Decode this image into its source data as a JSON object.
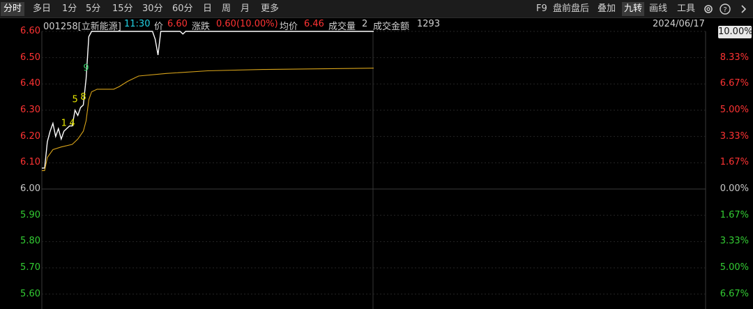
{
  "toolbar": {
    "tabs": [
      "分时",
      "多日",
      "1分",
      "5分",
      "15分",
      "30分",
      "60分",
      "日",
      "周",
      "月",
      "更多"
    ],
    "right_items": [
      "F9",
      "盘前盘后",
      "叠加",
      "九转",
      "画线",
      "工具"
    ],
    "icons": [
      "gear-icon",
      "help-icon",
      "close-icon",
      "chevron-right-icon"
    ]
  },
  "info_bar": {
    "code_name": "001258[立新能源]",
    "time": "11:30",
    "price_label": "价",
    "price": "6.60",
    "change_label": "涨跌",
    "change": "0.60(10.00%)",
    "avg_label": "均价",
    "avg": "6.46",
    "volume_label": "成交量",
    "volume": "2",
    "amount_label": "成交金额",
    "amount": "1293",
    "date": "2024/06/17"
  },
  "colors": {
    "up": "#ff3333",
    "down": "#33cc33",
    "price_line": "#ffffff",
    "avg_line": "#d9a41a",
    "grid": "#333333",
    "nine_turn": "#e6e600",
    "nine_final": "#33cc66"
  },
  "chart_data": {
    "type": "line",
    "prev_close": 6.0,
    "y_ticks": [
      "6.60",
      "6.50",
      "6.40",
      "6.30",
      "6.20",
      "6.10",
      "6.00",
      "5.90",
      "5.80",
      "5.70",
      "5.60"
    ],
    "pct_ticks": [
      "10.00%",
      "8.33%",
      "6.67%",
      "5.00%",
      "3.33%",
      "1.67%",
      "0.00%",
      "1.67%",
      "3.33%",
      "5.00%",
      "6.67%"
    ],
    "ylim": [
      5.58,
      6.62
    ],
    "session_minutes": 240,
    "series": [
      {
        "type": "price",
        "points": [
          [
            0,
            6.08
          ],
          [
            1,
            6.08
          ],
          [
            2,
            6.18
          ],
          [
            3,
            6.22
          ],
          [
            4,
            6.25
          ],
          [
            5,
            6.2
          ],
          [
            6,
            6.23
          ],
          [
            7,
            6.19
          ],
          [
            8,
            6.22
          ],
          [
            9,
            6.23
          ],
          [
            10,
            6.24
          ],
          [
            11,
            6.24
          ],
          [
            12,
            6.3
          ],
          [
            13,
            6.28
          ],
          [
            14,
            6.31
          ],
          [
            15,
            6.32
          ],
          [
            16,
            6.42
          ],
          [
            17,
            6.58
          ],
          [
            18,
            6.6
          ],
          [
            19,
            6.6
          ],
          [
            40,
            6.6
          ],
          [
            41,
            6.57
          ],
          [
            42,
            6.51
          ],
          [
            43,
            6.6
          ],
          [
            50,
            6.6
          ],
          [
            51,
            6.59
          ],
          [
            52,
            6.6
          ],
          [
            120,
            6.6
          ]
        ]
      },
      {
        "type": "avg",
        "points": [
          [
            0,
            6.07
          ],
          [
            1,
            6.07
          ],
          [
            2,
            6.12
          ],
          [
            4,
            6.15
          ],
          [
            7,
            6.16
          ],
          [
            11,
            6.17
          ],
          [
            13,
            6.19
          ],
          [
            15,
            6.22
          ],
          [
            16,
            6.26
          ],
          [
            17,
            6.34
          ],
          [
            18,
            6.37
          ],
          [
            20,
            6.38
          ],
          [
            26,
            6.38
          ],
          [
            28,
            6.39
          ],
          [
            31,
            6.41
          ],
          [
            35,
            6.43
          ],
          [
            45,
            6.44
          ],
          [
            60,
            6.45
          ],
          [
            80,
            6.455
          ],
          [
            120,
            6.46
          ]
        ]
      }
    ],
    "nine_turn_labels": [
      {
        "text": "1",
        "t": 8,
        "v": 6.24
      },
      {
        "text": "4",
        "t": 11,
        "v": 6.24
      },
      {
        "text": "5",
        "t": 12,
        "v": 6.33
      },
      {
        "text": "8",
        "t": 15,
        "v": 6.34
      },
      {
        "text": "9",
        "t": 16,
        "v": 6.45
      }
    ]
  }
}
